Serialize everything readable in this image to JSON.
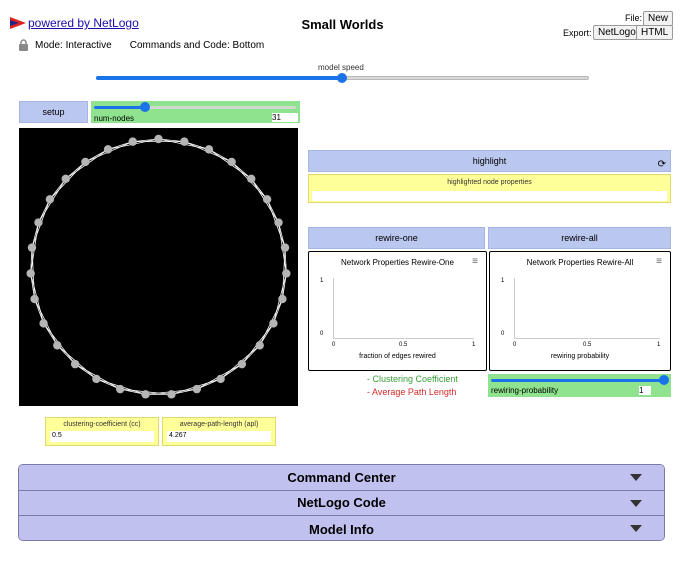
{
  "header": {
    "powered_by": "powered by NetLogo",
    "title": "Small Worlds",
    "mode_text": "Mode: Interactive",
    "commands_position": "Commands and Code: Bottom",
    "file_label": "File:",
    "new_label": "New",
    "export_label": "Export:",
    "export_netlogo": "NetLogo",
    "export_html": "HTML"
  },
  "speed": {
    "label": "model speed",
    "value": 0.5
  },
  "widgets": {
    "setup_label": "setup",
    "num_nodes": {
      "label": "num-nodes",
      "value": "31",
      "fraction": 0.25
    },
    "highlight_label": "highlight",
    "highlighted_props_label": "highlighted node properties",
    "highlighted_props_value": "",
    "rewire_one_label": "rewire-one",
    "rewire_all_label": "rewire-all",
    "cc": {
      "label": "clustering-coefficient (cc)",
      "value": "0.5"
    },
    "apl": {
      "label": "average-path-length (apl)",
      "value": "4.267"
    },
    "legend_cc": "- Clustering Coefficient",
    "legend_apl": "- Average Path Length",
    "rewiring_probability": {
      "label": "rewiring-probability",
      "value": "1",
      "fraction": 1.0
    }
  },
  "plots": {
    "rewire_one": {
      "title": "Network Properties Rewire-One",
      "xlabel": "fraction of edges rewired",
      "y_ticks": [
        "1",
        "0"
      ],
      "x_ticks": [
        "0",
        "0.5",
        "1"
      ]
    },
    "rewire_all": {
      "title": "Network Properties Rewire-All",
      "xlabel": "rewiring probability",
      "y_ticks": [
        "1",
        "0"
      ],
      "x_ticks": [
        "0",
        "0.5",
        "1"
      ]
    }
  },
  "network": {
    "nodes": 31
  },
  "accordion": [
    "Command Center",
    "NetLogo Code",
    "Model Info"
  ],
  "colors": {
    "button": "#bac7ee",
    "slider": "#8fe38f",
    "monitor": "#ffff99",
    "accordion": "#c1c1f0",
    "accent": "#1a73e8"
  },
  "icons": [
    "netlogo-logo-icon",
    "lock-icon",
    "refresh-icon",
    "hamburger-menu-icon",
    "chevron-down-icon"
  ]
}
